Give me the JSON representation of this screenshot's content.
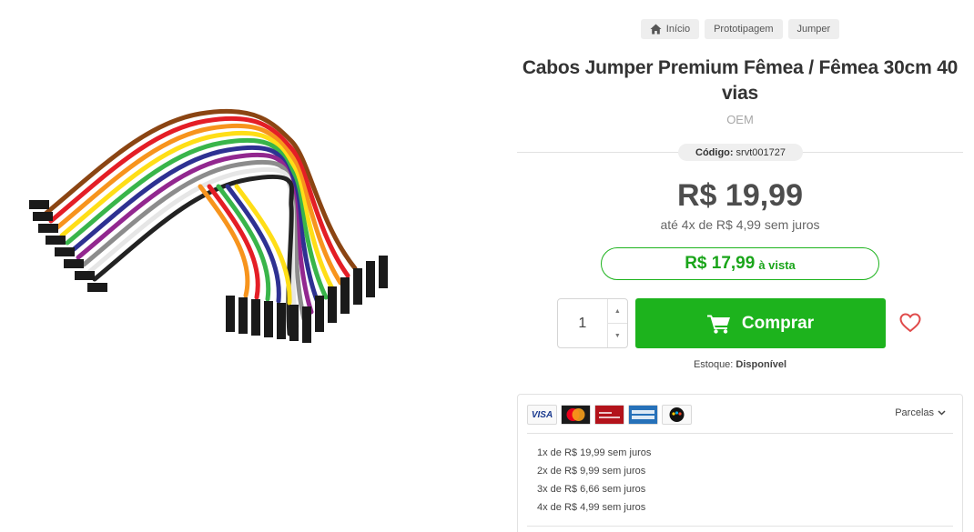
{
  "breadcrumb": {
    "home": "Início",
    "category": "Prototipagem",
    "subcategory": "Jumper"
  },
  "product": {
    "title": "Cabos Jumper Premium Fêmea / Fêmea 30cm 40 vias",
    "brand": "OEM",
    "code_label": "Código:",
    "code_value": "srvt001727",
    "price": "R$ 19,99",
    "installments_summary": "até 4x de R$ 4,99 sem juros",
    "cash_price": "R$ 17,99",
    "cash_label": "à vista"
  },
  "purchase": {
    "quantity": "1",
    "buy_label": "Comprar",
    "stock_label": "Estoque:",
    "stock_value": "Disponível"
  },
  "payment": {
    "cards": [
      "visa",
      "mastercard",
      "hipercard",
      "american-express",
      "elo"
    ],
    "visa_text": "VISA",
    "toggle_label": "Parcelas",
    "installments": [
      "1x de R$ 19,99 sem juros",
      "2x de R$ 9,99 sem juros",
      "3x de R$ 6,66 sem juros",
      "4x de R$ 4,99 sem juros"
    ]
  },
  "colors": {
    "accent_green": "#1db31d",
    "wishlist_red": "#e04a4a"
  }
}
